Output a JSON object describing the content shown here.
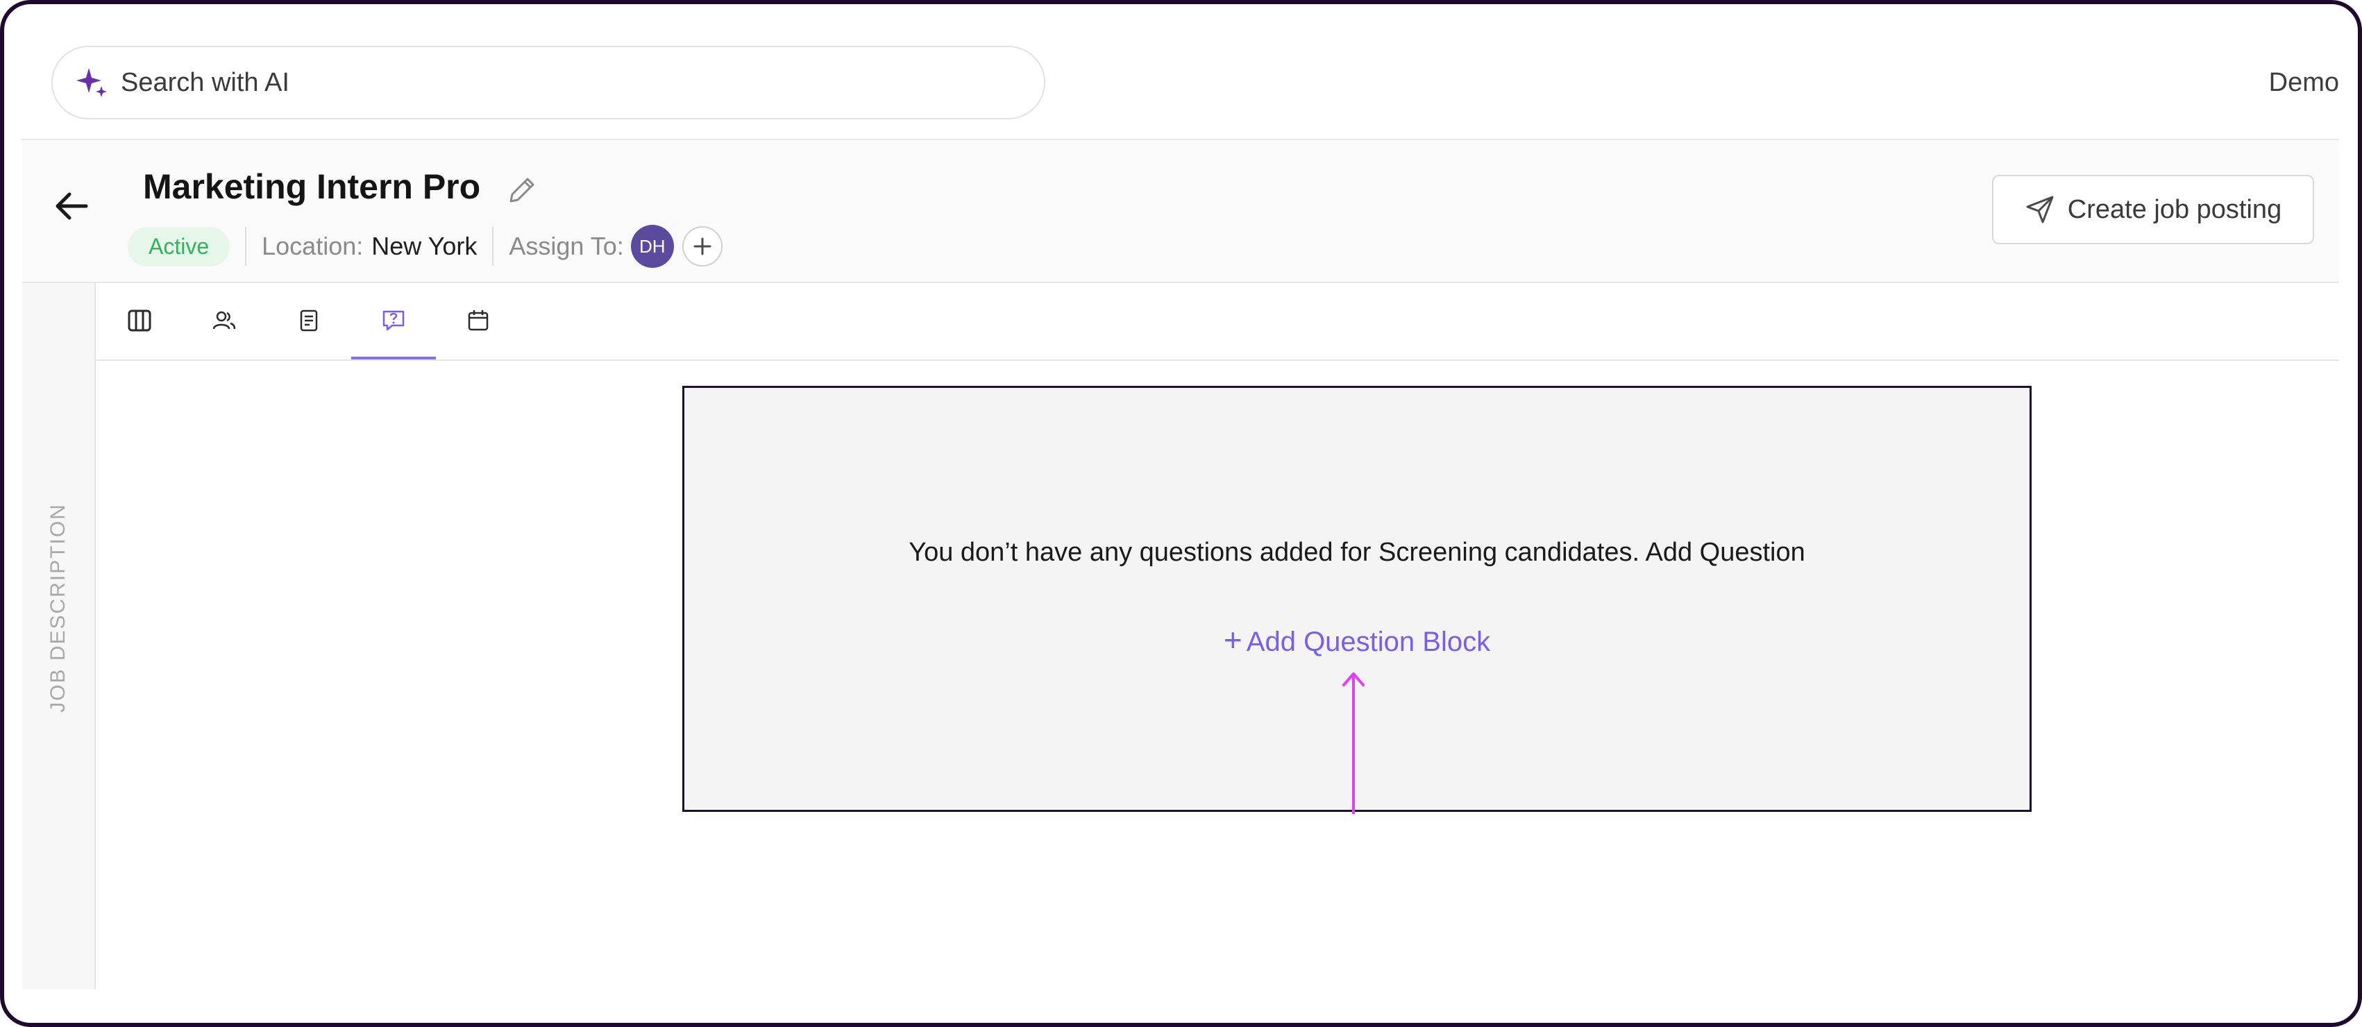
{
  "search": {
    "placeholder": "Search with AI",
    "icon": "sparkle-icon"
  },
  "header": {
    "user_name": "Demo"
  },
  "job": {
    "title": "Marketing Intern Pro",
    "status": "Active",
    "location_label": "Location:",
    "location_value": "New York",
    "assign_label": "Assign To:",
    "assignee_initials": "DH",
    "create_posting_label": "Create job posting"
  },
  "sidebar": {
    "vertical_label": "JOB DESCRIPTION"
  },
  "tabs": [
    {
      "icon": "columns-icon",
      "active": false
    },
    {
      "icon": "users-icon",
      "active": false
    },
    {
      "icon": "document-icon",
      "active": false
    },
    {
      "icon": "question-chat-icon",
      "active": true
    },
    {
      "icon": "calendar-icon",
      "active": false
    }
  ],
  "empty_state": {
    "message": "You don’t have any questions added for Screening candidates. Add Question",
    "add_block_label": "Add Question Block",
    "add_block_plus": "+"
  },
  "colors": {
    "accent": "#7b5ee6",
    "status_green": "#2fb35b",
    "avatar": "#5b4a9e",
    "annotation_arrow": "#e040fb",
    "frame": "#1e0a2e"
  }
}
